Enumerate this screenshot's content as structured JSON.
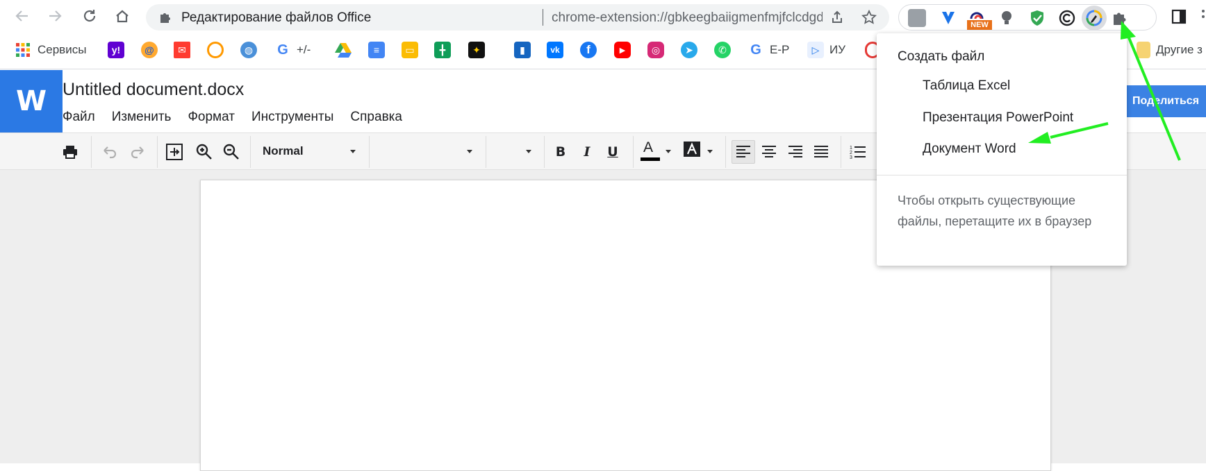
{
  "browser": {
    "tab_title": "Редактирование файлов Office",
    "url": "chrome-extension://gbkeegbaiigmenfmjfclcdgdpimamgkj/vie...",
    "extensions": {
      "new_badge": "NEW"
    }
  },
  "bookmarks": {
    "apps": "Сервисы",
    "plusminus": "+/-",
    "ep": "E-P",
    "iu": "ИУ",
    "others": "Другие з"
  },
  "app": {
    "logo": "W",
    "doc_title": "Untitled document.docx",
    "menu": [
      "Файл",
      "Изменить",
      "Формат",
      "Инструменты",
      "Справка"
    ],
    "share": "Поделиться"
  },
  "toolbar": {
    "style_value": "Normal",
    "font_value": "",
    "size_value": "",
    "bold": "B",
    "italic": "I",
    "underline": "U",
    "text_color_glyph": "A"
  },
  "popup": {
    "heading": "Создать файл",
    "items": [
      "Таблица Excel",
      "Презентация PowerPoint",
      "Документ Word"
    ],
    "hint": "Чтобы открыть существующие файлы, перетащите их в браузер"
  },
  "colors": {
    "accent": "#2b79e4",
    "share": "#3b82e4",
    "arrow": "#22ee22"
  }
}
